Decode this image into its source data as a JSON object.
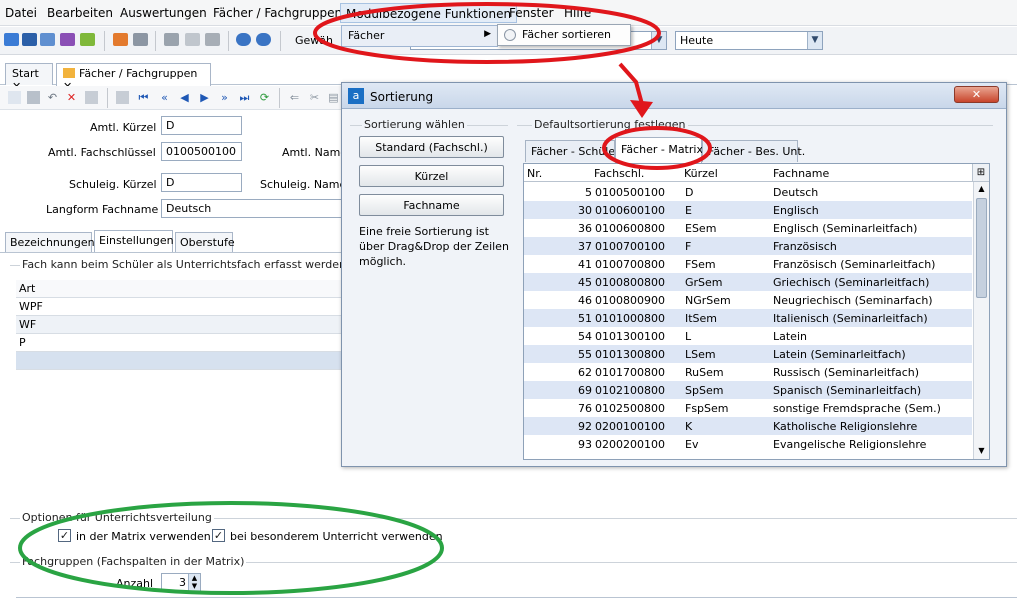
{
  "menu": [
    "Datei",
    "Bearbeiten",
    "Auswertungen",
    "Fächer / Fachgruppen",
    "Modulbezogene Funktionen",
    "Fenster",
    "Hilfe"
  ],
  "submenu": {
    "item": "Fächer",
    "sub_item": "Fächer sortieren"
  },
  "toolbar": {
    "label": "Gewäh",
    "date_combo": "Heute"
  },
  "doc_tabs": [
    "Start",
    "Fächer / Fachgruppen"
  ],
  "form": {
    "amtl_kuerzel_label": "Amtl. Kürzel",
    "amtl_kuerzel": "D",
    "amtl_fachschluessel_label": "Amtl. Fachschlüssel",
    "amtl_fachschluessel": "0100500100",
    "amtl_name_label": "Amtl. Name",
    "schuleig_kuerzel_label": "Schuleig. Kürzel",
    "schuleig_kuerzel": "D",
    "schuleig_name_label": "Schuleig. Name",
    "langform_label": "Langform Fachname",
    "langform": "Deutsch"
  },
  "sub_tabs": [
    "Bezeichnungen",
    "Einstellungen",
    "Oberstufe"
  ],
  "fach_group": {
    "title": "Fach kann beim Schüler als Unterrichtsfach erfasst werden",
    "header": "Art",
    "rows": [
      "WPF",
      "WF",
      "P"
    ]
  },
  "options": {
    "title": "Optionen für Unterrichtsverteilung",
    "check1": "in der Matrix verwenden",
    "check2": "bei besonderem Unterricht verwenden",
    "fachgruppen_title": "Fachgruppen (Fachspalten in der Matrix)",
    "anzahl_label": "Anzahl",
    "anzahl": "3"
  },
  "dialog": {
    "title": "Sortierung",
    "left_group": "Sortierung wählen",
    "buttons": [
      "Standard (Fachschl.)",
      "Kürzel",
      "Fachname"
    ],
    "hint": [
      "Eine freie Sortierung ist",
      "über Drag&Drop der Zeilen",
      "möglich."
    ],
    "right_group": "Defaultsortierung festlegen",
    "tabs": [
      "Fächer - Schüler",
      "Fächer - Matrix",
      "Fächer - Bes. Unt."
    ],
    "columns": [
      "Nr.",
      "Fachschl.",
      "Kürzel",
      "Fachname"
    ],
    "rows": [
      {
        "nr": "5",
        "fs": "0100500100",
        "k": "D",
        "name": "Deutsch"
      },
      {
        "nr": "30",
        "fs": "0100600100",
        "k": "E",
        "name": "Englisch"
      },
      {
        "nr": "36",
        "fs": "0100600800",
        "k": "ESem",
        "name": "Englisch (Seminarleitfach)"
      },
      {
        "nr": "37",
        "fs": "0100700100",
        "k": "F",
        "name": "Französisch"
      },
      {
        "nr": "41",
        "fs": "0100700800",
        "k": "FSem",
        "name": "Französisch (Seminarleitfach)"
      },
      {
        "nr": "45",
        "fs": "0100800800",
        "k": "GrSem",
        "name": "Griechisch (Seminarleitfach)"
      },
      {
        "nr": "46",
        "fs": "0100800900",
        "k": "NGrSem",
        "name": "Neugriechisch (Seminarfach)"
      },
      {
        "nr": "51",
        "fs": "0101000800",
        "k": "ItSem",
        "name": "Italienisch (Seminarleitfach)"
      },
      {
        "nr": "54",
        "fs": "0101300100",
        "k": "L",
        "name": "Latein"
      },
      {
        "nr": "55",
        "fs": "0101300800",
        "k": "LSem",
        "name": "Latein (Seminarleitfach)"
      },
      {
        "nr": "62",
        "fs": "0101700800",
        "k": "RuSem",
        "name": "Russisch (Seminarleitfach)"
      },
      {
        "nr": "69",
        "fs": "0102100800",
        "k": "SpSem",
        "name": "Spanisch (Seminarleitfach)"
      },
      {
        "nr": "76",
        "fs": "0102500800",
        "k": "FspSem",
        "name": "sonstige Fremdsprache (Sem.)"
      },
      {
        "nr": "92",
        "fs": "0200100100",
        "k": "K",
        "name": "Katholische Religionslehre"
      },
      {
        "nr": "93",
        "fs": "0200200100",
        "k": "Ev",
        "name": "Evangelische Religionslehre"
      }
    ]
  },
  "colors": {
    "red_annotation": "#e0161b",
    "green_annotation": "#2aa443",
    "accent": "#1f58b5"
  }
}
